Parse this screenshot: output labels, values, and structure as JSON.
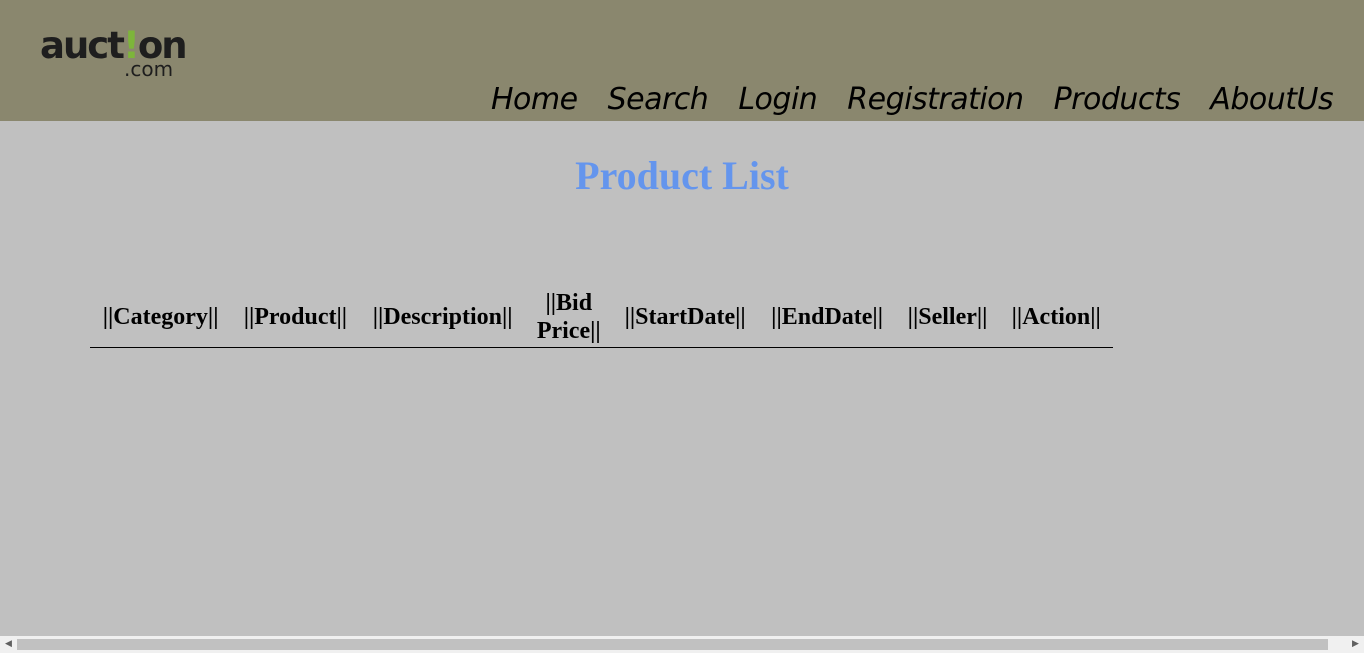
{
  "header": {
    "logo": {
      "text_before": "auct",
      "text_bang": "!",
      "text_after": "on",
      "text_domain": ".com"
    },
    "nav": [
      "Home",
      "Search",
      "Login",
      "Registration",
      "Products",
      "AboutUs"
    ]
  },
  "page": {
    "title": "Product List"
  },
  "table": {
    "headers": [
      "||Category||",
      "||Product||",
      "||Description||",
      "||Bid Price||",
      "||StartDate||",
      "||EndDate||",
      "||Seller||",
      "||Action||"
    ]
  },
  "colors": {
    "header_bg": "#8a876e",
    "page_bg": "#c0c0c0",
    "title": "#6495ed",
    "logo_accent": "#7db53a"
  },
  "icons": {
    "scroll_left": "triangle-left",
    "scroll_right": "triangle-right"
  }
}
